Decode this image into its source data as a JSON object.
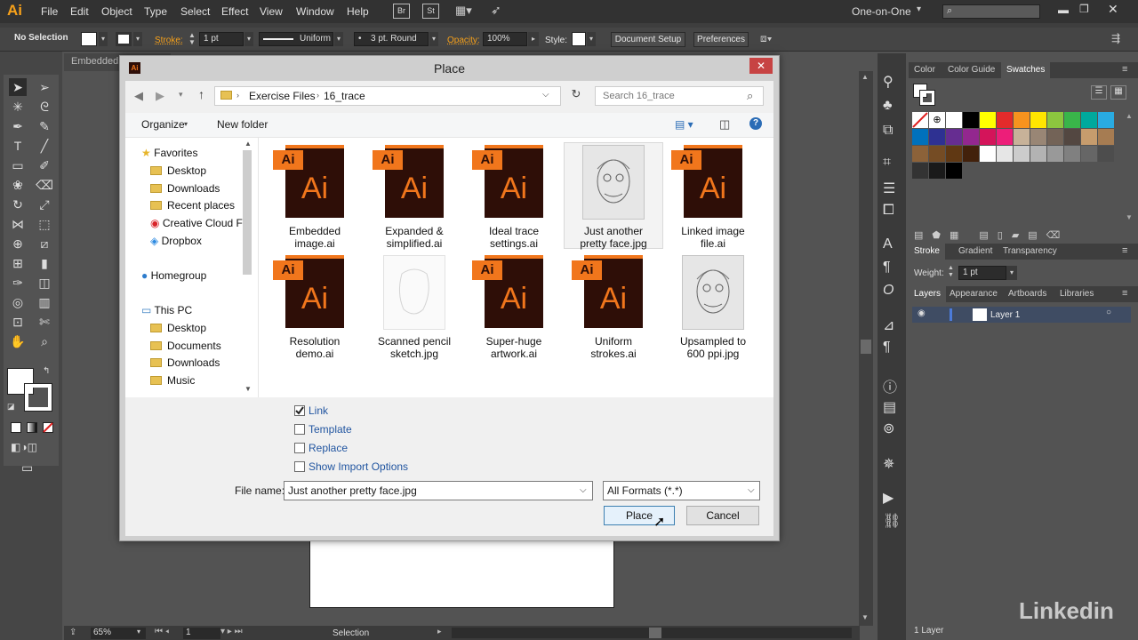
{
  "app": {
    "logo": "Ai",
    "menus": [
      "File",
      "Edit",
      "Object",
      "Type",
      "Select",
      "Effect",
      "View",
      "Window",
      "Help"
    ],
    "bridge_buttons": [
      "Br",
      "St"
    ],
    "workspace": "One-on-One"
  },
  "control_bar": {
    "selection": "No Selection",
    "stroke_label": "Stroke:",
    "stroke_weight": "1 pt",
    "stroke_profile": "Uniform",
    "brush": "3 pt. Round",
    "opacity_label": "Opacity:",
    "opacity_value": "100%",
    "style_label": "Style:",
    "doc_setup": "Document Setup",
    "preferences": "Preferences"
  },
  "document": {
    "tab": "Embedded"
  },
  "status_bar": {
    "zoom": "65%",
    "artboard_num": "1",
    "tool_status": "Selection"
  },
  "right_panel": {
    "swatch_tabs": [
      "Color",
      "Color Guide",
      "Swatches"
    ],
    "active_swatch_tab": "Swatches",
    "swatch_colors": [
      "#ffffff",
      "#000000",
      "#ffff00",
      "#e32b2b",
      "#f7931e",
      "#ffe600",
      "#8cc63f",
      "#39b54a",
      "#00a99d",
      "#29abe2",
      "#0071bc",
      "#2e3192",
      "#662d91",
      "#93278f",
      "#d4145a",
      "#ed1e79",
      "#c7b299",
      "#998675",
      "#736357",
      "#534741",
      "#c69c6d",
      "#a67c52",
      "#8c6239",
      "#754c24",
      "#603813",
      "#42210b",
      "#ffffff",
      "#e6e6e6",
      "#cccccc",
      "#b3b3b3",
      "#999999",
      "#808080",
      "#666666",
      "#4d4d4d",
      "#333333",
      "#1a1a1a",
      "#000000"
    ],
    "stroke_tabs": [
      "Stroke",
      "Gradient",
      "Transparency"
    ],
    "stroke_weight_label": "Weight:",
    "stroke_weight": "1 pt",
    "layer_tabs": [
      "Layers",
      "Appearance",
      "Artboards",
      "Libraries"
    ],
    "layer_name": "Layer 1",
    "layer_count": "1 Layer"
  },
  "dialog": {
    "title": "Place",
    "breadcrumb": [
      "Exercise Files",
      "16_trace"
    ],
    "search_placeholder": "Search 16_trace",
    "organize": "Organize",
    "new_folder": "New folder",
    "nav": {
      "favorites": "Favorites",
      "fav_items": [
        "Desktop",
        "Downloads",
        "Recent places",
        "Creative Cloud Fi",
        "Dropbox"
      ],
      "homegroup": "Homegroup",
      "this_pc": "This PC",
      "pc_items": [
        "Desktop",
        "Documents",
        "Downloads",
        "Music"
      ]
    },
    "files": [
      {
        "name1": "Embedded",
        "name2": "image.ai",
        "kind": "ai"
      },
      {
        "name1": "Expanded &",
        "name2": "simplified.ai",
        "kind": "ai"
      },
      {
        "name1": "Ideal trace",
        "name2": "settings.ai",
        "kind": "ai"
      },
      {
        "name1": "Just another",
        "name2": "pretty face.jpg",
        "kind": "sketch"
      },
      {
        "name1": "Linked image",
        "name2": "file.ai",
        "kind": "ai"
      },
      {
        "name1": "Resolution",
        "name2": "demo.ai",
        "kind": "ai"
      },
      {
        "name1": "Scanned pencil",
        "name2": "sketch.jpg",
        "kind": "faint"
      },
      {
        "name1": "Super-huge",
        "name2": "artwork.ai",
        "kind": "ai"
      },
      {
        "name1": "Uniform",
        "name2": "strokes.ai",
        "kind": "ai"
      },
      {
        "name1": "Upsampled to",
        "name2": "600 ppi.jpg",
        "kind": "sketch"
      }
    ],
    "options": [
      {
        "label": "Link",
        "checked": true
      },
      {
        "label": "Template",
        "checked": false
      },
      {
        "label": "Replace",
        "checked": false
      },
      {
        "label": "Show Import Options",
        "checked": false
      }
    ],
    "file_name_label": "File name:",
    "file_name": "Just another pretty face.jpg",
    "format": "All Formats (*.*)",
    "place_button": "Place",
    "cancel_button": "Cancel"
  },
  "watermark": "Linkedin"
}
